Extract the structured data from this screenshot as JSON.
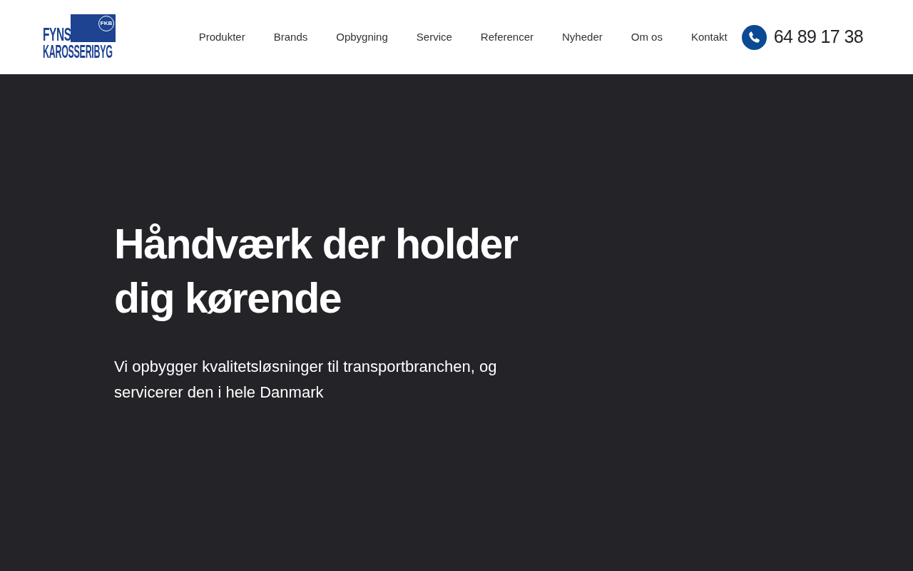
{
  "logo": {
    "line_1": "FYNS",
    "line_2": "KAROSSERIBYG",
    "badge": "FKB"
  },
  "nav": [
    {
      "label": "Produkter"
    },
    {
      "label": "Brands"
    },
    {
      "label": "Opbygning"
    },
    {
      "label": "Service"
    },
    {
      "label": "Referencer"
    },
    {
      "label": "Nyheder"
    },
    {
      "label": "Om os"
    },
    {
      "label": "Kontakt"
    }
  ],
  "phone": "64 89 17 38",
  "hero": {
    "heading": "Håndværk der holder dig kørende",
    "text": "Vi opbygger kvalitetsløsninger til transportbranchen, og servicerer den i hele Danmark"
  }
}
